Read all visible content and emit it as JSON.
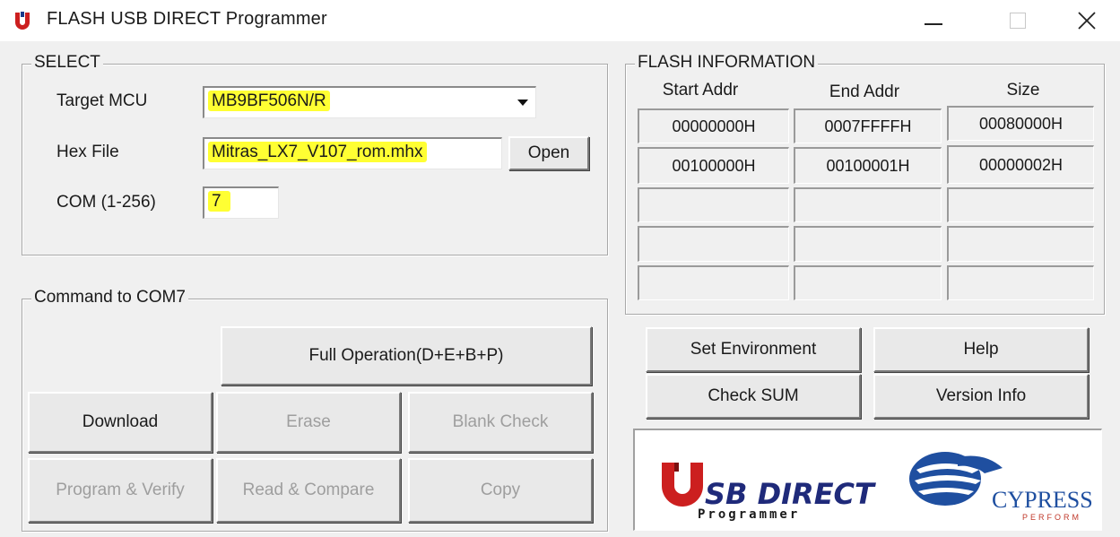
{
  "window": {
    "title": "FLASH USB DIRECT Programmer",
    "icon": "u-logo-icon",
    "controls": [
      "minimize",
      "maximize",
      "close"
    ]
  },
  "select": {
    "group_label": "SELECT",
    "target_mcu_label": "Target MCU",
    "target_mcu_value": "MB9BF506N/R",
    "hex_file_label": "Hex File",
    "hex_file_value": "Mitras_LX7_V107_rom.mhx",
    "open_button": "Open",
    "com_label": "COM (1-256)",
    "com_value": "7"
  },
  "flash_info": {
    "group_label": "FLASH INFORMATION",
    "columns": [
      "Start Addr",
      "End Addr",
      "Size"
    ],
    "rows": [
      [
        "00000000H",
        "0007FFFFH",
        "00080000H"
      ],
      [
        "00100000H",
        "00100001H",
        "00000002H"
      ],
      [
        "",
        "",
        ""
      ],
      [
        "",
        "",
        ""
      ],
      [
        "",
        "",
        ""
      ]
    ]
  },
  "command": {
    "group_label": "Command  to  COM7",
    "full_operation": "Full Operation(D+E+B+P)",
    "download": "Download",
    "erase": "Erase",
    "blank_check": "Blank Check",
    "program_verify": "Program & Verify",
    "read_compare": "Read & Compare",
    "copy": "Copy"
  },
  "side_buttons": {
    "set_environment": "Set Environment",
    "help": "Help",
    "check_sum": "Check SUM",
    "version_info": "Version Info"
  },
  "logos": {
    "usb_direct_u": "U",
    "usb_direct_main": "SB DIRECT",
    "usb_direct_sub": "Programmer",
    "cypress_name": "CYPRESS",
    "cypress_tagline": "PERFORM"
  },
  "colors": {
    "highlight": "#ffff33",
    "window_bg": "#f0f0f0",
    "usb_red": "#cc1f1f",
    "cypress_blue": "#1f4fa0"
  }
}
